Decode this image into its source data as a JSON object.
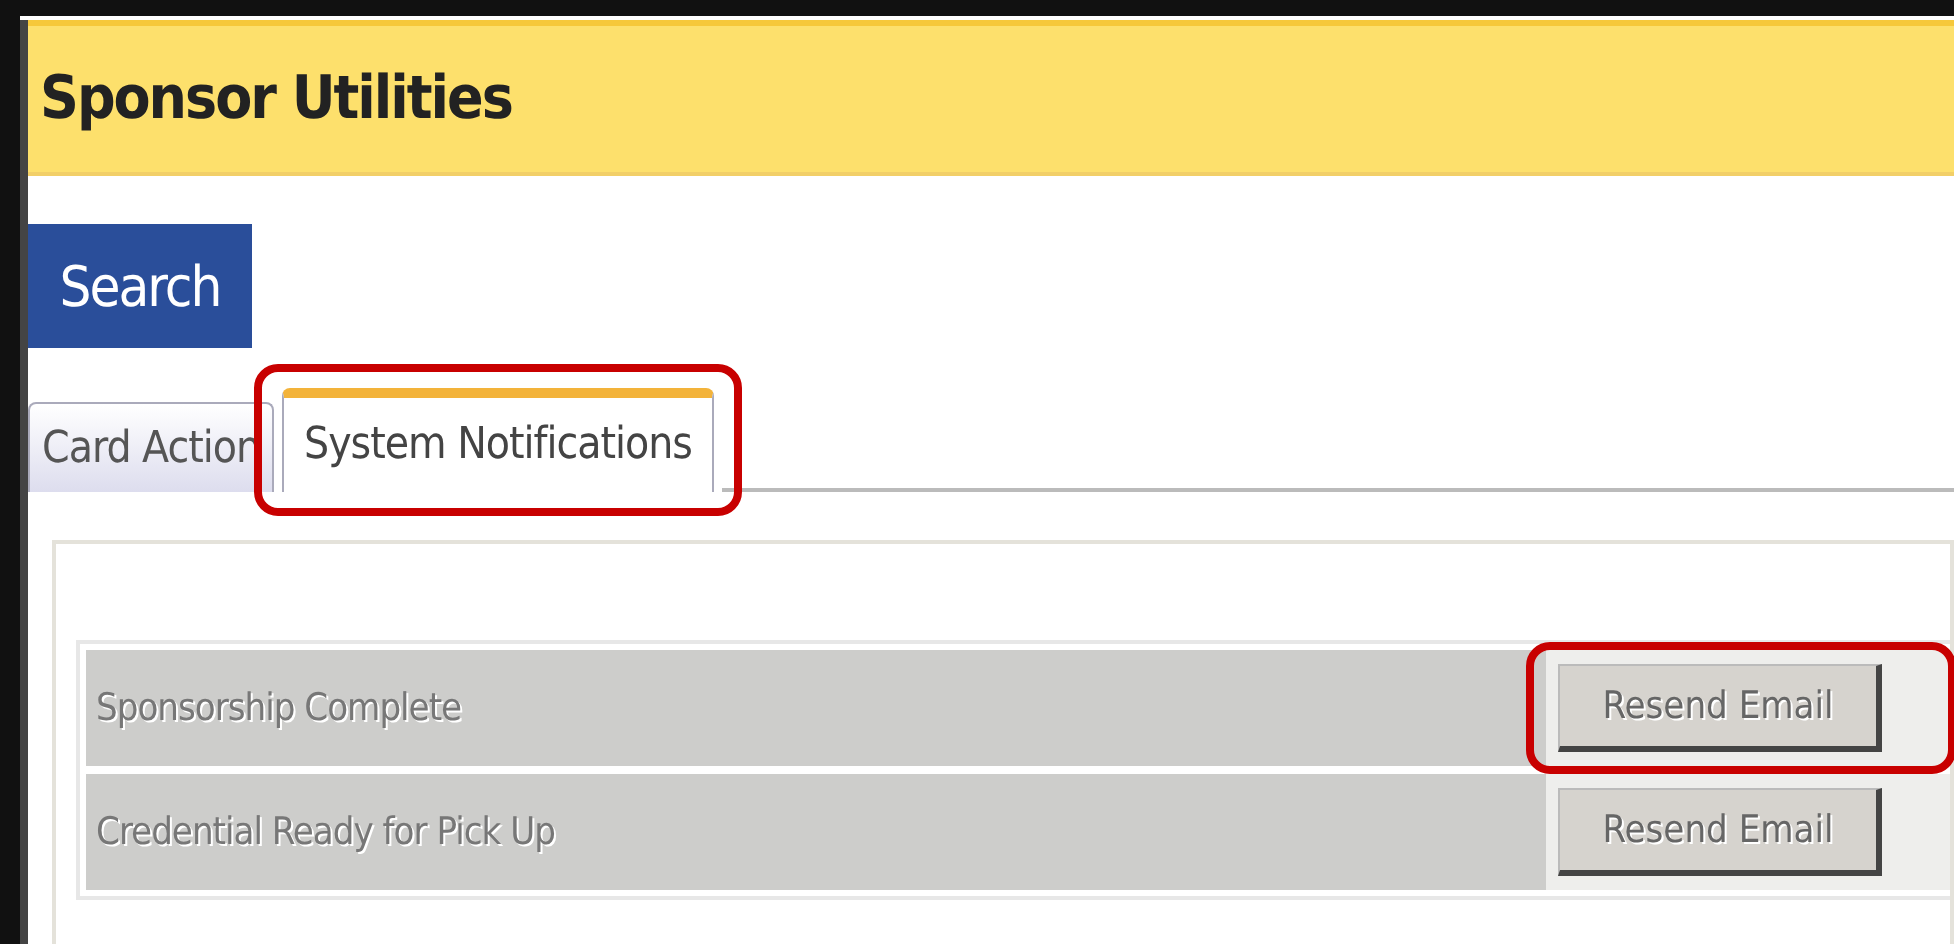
{
  "header": {
    "title": "Sponsor Utilities"
  },
  "search_button": {
    "label": "Search"
  },
  "tabs": [
    {
      "label": "Card Action",
      "selected": false,
      "highlighted": false
    },
    {
      "label": "System Notifications",
      "selected": true,
      "highlighted": true
    }
  ],
  "notifications": [
    {
      "name": "Sponsorship Complete",
      "button": "Resend Email",
      "highlighted": true
    },
    {
      "name": "Credential Ready for Pick Up",
      "button": "Resend Email",
      "highlighted": false
    }
  ]
}
